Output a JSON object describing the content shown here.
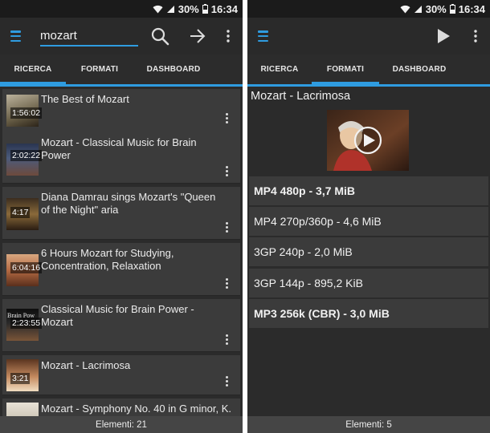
{
  "status": {
    "battery": "30%",
    "time": "16:34"
  },
  "left": {
    "search_value": "mozart",
    "tabs": [
      "RICERCA",
      "FORMATI",
      "DASHBOARD"
    ],
    "results": [
      {
        "title": "The Best of Mozart",
        "duration": "1:56:02"
      },
      {
        "title": "Mozart - Classical Music for Brain Power",
        "duration": "2:02:22"
      },
      {
        "title": "Diana Damrau sings Mozart's \"Queen of the Night\" aria",
        "duration": "4:17"
      },
      {
        "title": "6 Hours Mozart for Studying, Concentration, Relaxation",
        "duration": "6:04:16"
      },
      {
        "title": "Classical Music for Brain Power - Mozart",
        "duration": "2:23:55"
      },
      {
        "title": "Mozart - Lacrimosa",
        "duration": "3:21"
      },
      {
        "title": "Mozart - Symphony No. 40 in G minor, K.",
        "duration": ""
      }
    ],
    "footer": "Elementi: 21"
  },
  "right": {
    "tabs": [
      "RICERCA",
      "FORMATI",
      "DASHBOARD"
    ],
    "video_title": "Mozart - Lacrimosa",
    "formats": [
      {
        "label": "MP4 480p - 3,7 MiB",
        "bold": true
      },
      {
        "label": "MP4 270p/360p - 4,6 MiB",
        "bold": false
      },
      {
        "label": "3GP 240p - 2,0 MiB",
        "bold": false
      },
      {
        "label": "3GP 144p - 895,2 KiB",
        "bold": false
      },
      {
        "label": "MP3 256k (CBR) - 3,0 MiB",
        "bold": true
      }
    ],
    "footer": "Elementi: 5"
  },
  "thumb_overlays": {
    "1": "Brain Pow"
  },
  "colors": {
    "accent": "#2f9ce0",
    "background": "#2f2f2f",
    "item": "#3b3b3b",
    "footer": "#454545"
  },
  "icons": {
    "menu": "hamburger-icon",
    "search": "search-icon",
    "go": "arrow-right-icon",
    "more": "overflow-menu-icon",
    "play": "play-icon",
    "wifi": "wifi-icon",
    "signal": "signal-icon",
    "battery": "battery-icon"
  }
}
